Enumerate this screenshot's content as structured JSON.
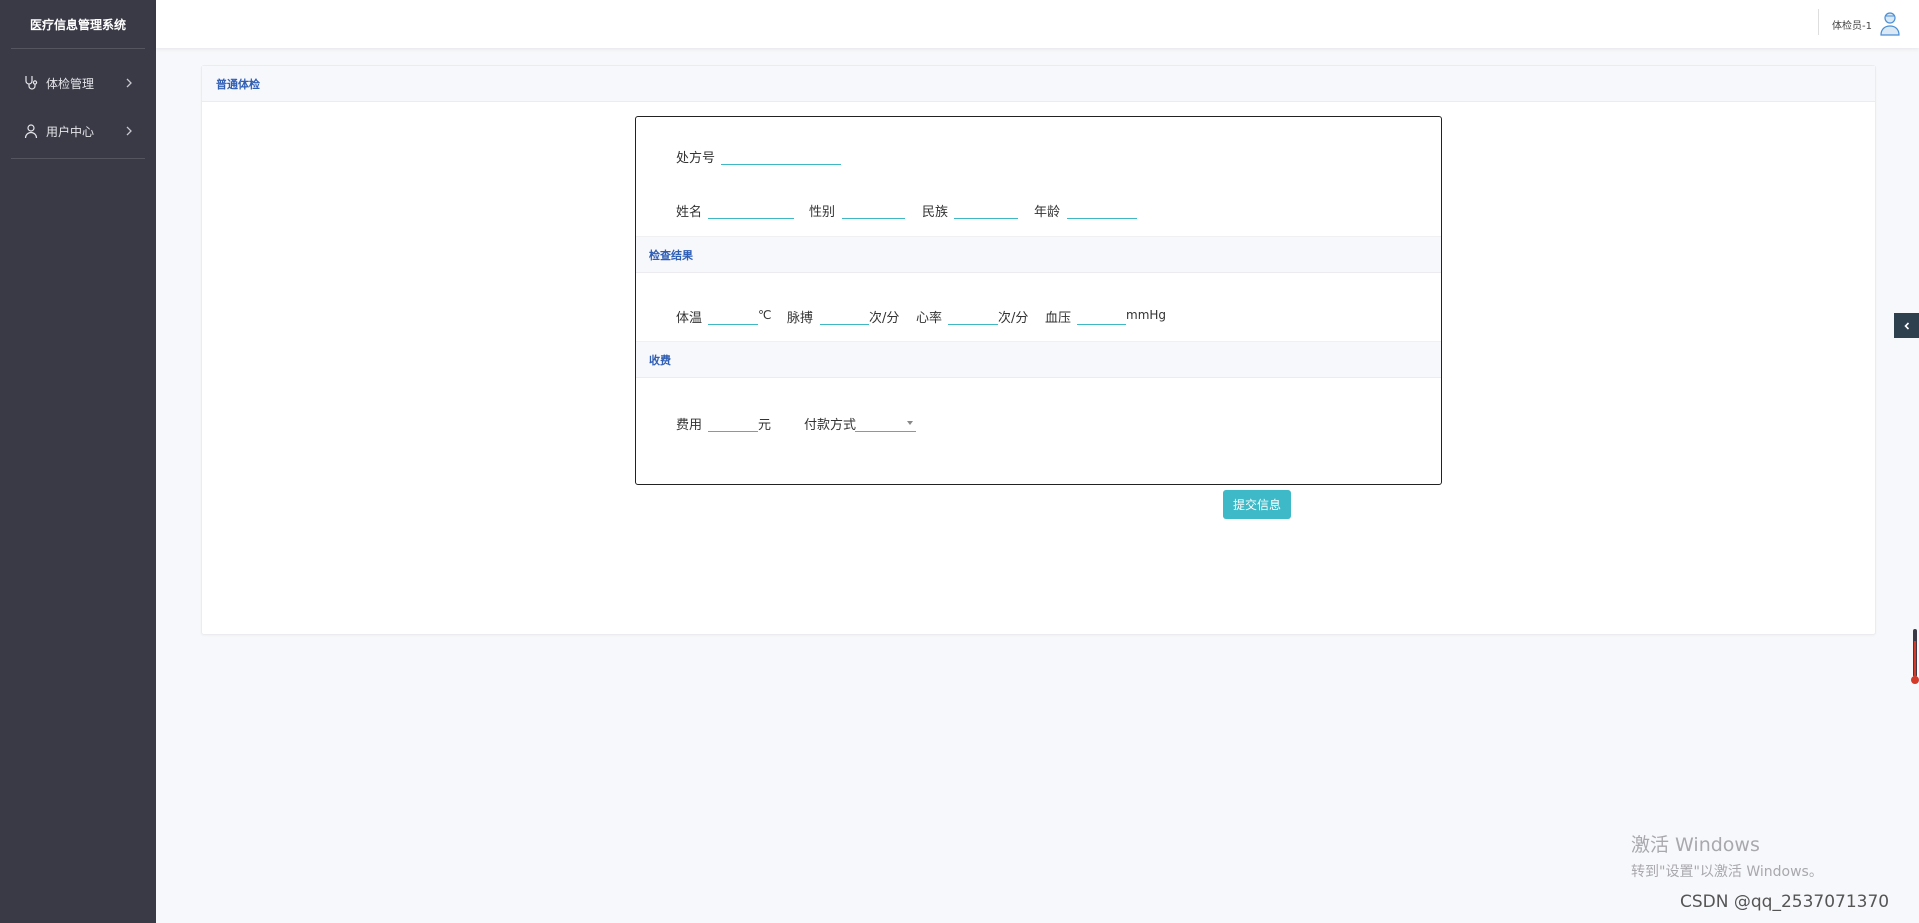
{
  "app": {
    "title": "医疗信息管理系统"
  },
  "sidebar": {
    "items": [
      {
        "label": "体检管理",
        "icon": "stethoscope-icon"
      },
      {
        "label": "用户中心",
        "icon": "user-icon"
      }
    ]
  },
  "topbar": {
    "user_label": "体检员-1"
  },
  "card": {
    "title": "普通体检"
  },
  "form": {
    "prescription_label": "处方号",
    "prescription_value": "",
    "name_label": "姓名",
    "name_value": "",
    "gender_label": "性别",
    "gender_value": "",
    "ethnicity_label": "民族",
    "ethnicity_value": "",
    "age_label": "年龄",
    "age_value": "",
    "section_results": "检查结果",
    "temp_label": "体温",
    "temp_value": "",
    "temp_unit": "℃",
    "pulse_label": "脉搏",
    "pulse_value": "",
    "pulse_unit": "次/分",
    "heart_label": "心率",
    "heart_value": "",
    "heart_unit": "次/分",
    "bp_label": "血压",
    "bp_value": "",
    "bp_unit": "mmHg",
    "section_fee": "收费",
    "fee_label": "费用",
    "fee_value": "",
    "fee_unit": "元",
    "payment_label": "付款方式",
    "payment_value": ""
  },
  "submit_label": "提交信息",
  "watermark": {
    "line1": "激活 Windows",
    "line2": "转到\"设置\"以激活 Windows。"
  },
  "footer_credit": "CSDN @qq_2537071370",
  "colors": {
    "sidebar_bg": "#3a3a46",
    "accent": "#3db9c7",
    "section_title": "#2f5eb5",
    "page_bg": "#f7f8fb"
  }
}
